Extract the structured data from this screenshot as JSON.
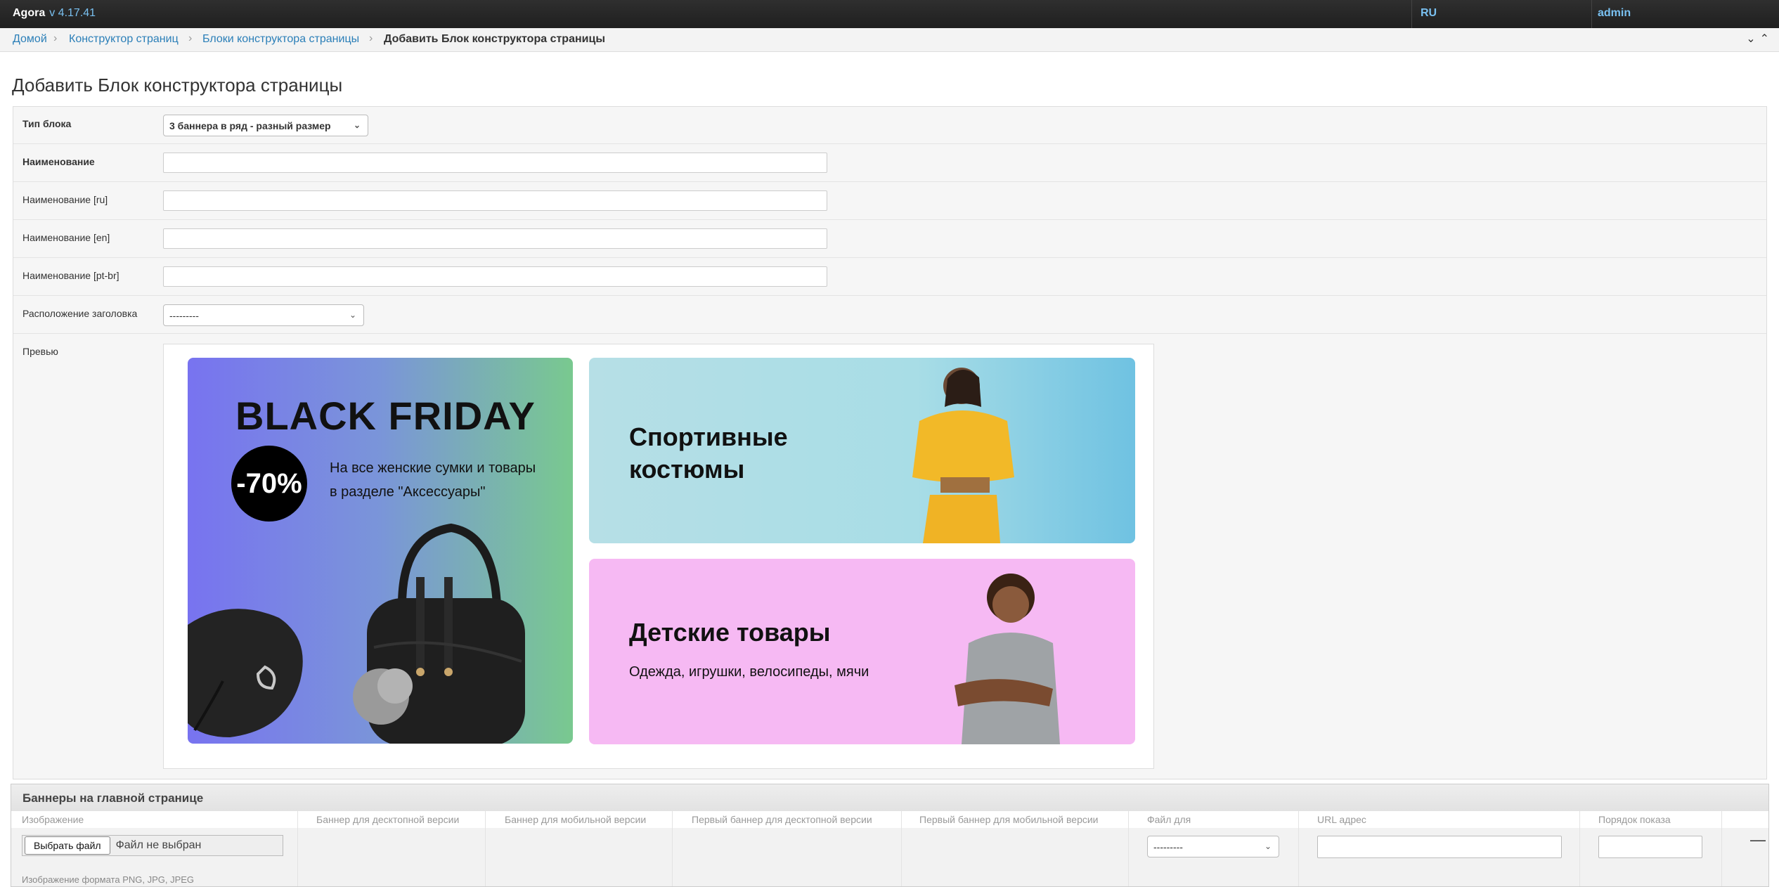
{
  "header": {
    "app_name": "Agora",
    "version": "v 4.17.41",
    "language": "RU",
    "user": "admin"
  },
  "breadcrumbs": {
    "items": [
      "Домой",
      "Конструктор страниц",
      "Блоки конструктора страницы"
    ],
    "current": "Добавить Блок конструктора страницы",
    "separator": "›"
  },
  "page": {
    "title": "Добавить Блок конструктора страницы"
  },
  "form": {
    "block_type_label": "Тип блока",
    "block_type_value": "3 баннера в ряд - разный размер",
    "name_label": "Наименование",
    "name_ru_label": "Наименование [ru]",
    "name_en_label": "Наименование [en]",
    "name_ptbr_label": "Наименование [pt-br]",
    "title_position_label": "Расположение заголовка",
    "title_position_value": "---------",
    "preview_label": "Превью"
  },
  "preview": {
    "banner1": {
      "title": "BLACK FRIDAY",
      "discount": "-70%",
      "subtitle_line1": "На все женские сумки и товары",
      "subtitle_line2": "в разделе \"Аксессуары\""
    },
    "banner2": {
      "title_line1": "Спортивные",
      "title_line2": "костюмы"
    },
    "banner3": {
      "title": "Детские товары",
      "subtitle": "Одежда, игрушки, велосипеды, мячи"
    }
  },
  "inline": {
    "title": "Баннеры на главной странице",
    "columns": [
      "Изображение",
      "Баннер для десктопной версии",
      "Баннер для мобильной версии",
      "Первый баннер для десктопной версии",
      "Первый баннер для мобильной версии",
      "Файл для",
      "URL адрес",
      "Порядок показа"
    ],
    "file_button": "Выбрать файл",
    "file_status": "Файл не выбран",
    "hint": "Изображение формата PNG, JPG, JPEG",
    "file_for_value": "---------",
    "remove_symbol": "—"
  }
}
